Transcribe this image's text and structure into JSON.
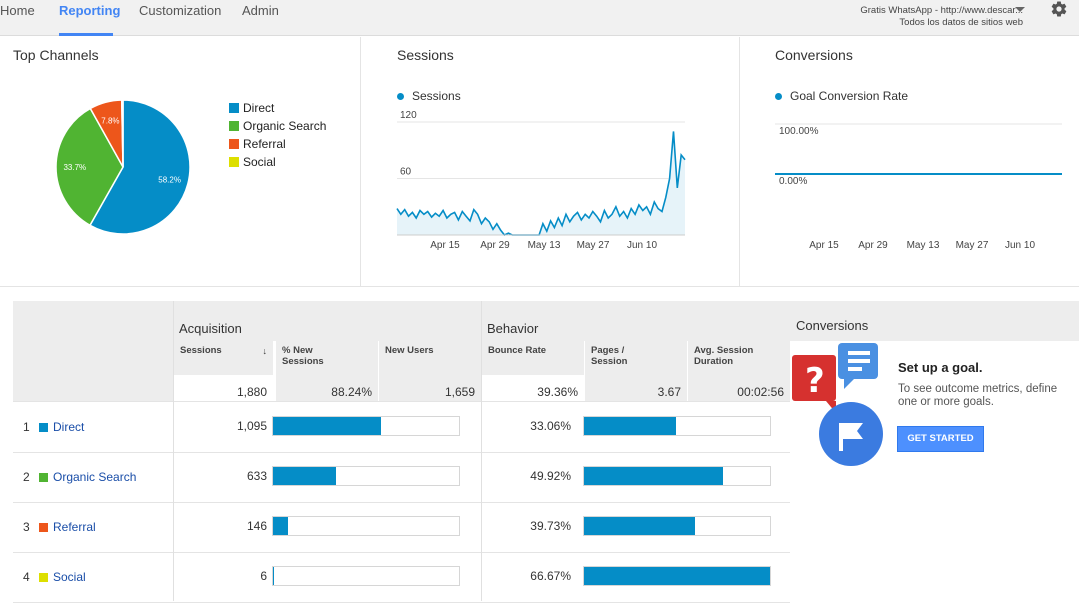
{
  "nav": {
    "tabs": [
      {
        "label": "Home"
      },
      {
        "label": "Reporting"
      },
      {
        "label": "Customization"
      },
      {
        "label": "Admin"
      }
    ],
    "account_line1": "Gratis WhatsApp - http://www.descar...",
    "account_line2": "Todos los datos de sitios web",
    "icons": [
      "chevron-down-icon",
      "gear-icon"
    ]
  },
  "top_channels": {
    "title": "Top Channels",
    "legend": [
      {
        "label": "Direct",
        "color": "#058dc7"
      },
      {
        "label": "Organic Search",
        "color": "#50b432"
      },
      {
        "label": "Referral",
        "color": "#ed561b"
      },
      {
        "label": "Social",
        "color": "#dddf00"
      }
    ]
  },
  "sessions_panel": {
    "title": "Sessions",
    "legend": "Sessions"
  },
  "conversions_panel": {
    "title": "Conversions",
    "legend": "Goal Conversion Rate"
  },
  "chart_data": [
    {
      "type": "pie",
      "title": "Top Channels",
      "categories": [
        "Direct",
        "Organic Search",
        "Referral",
        "Social"
      ],
      "values": [
        58.2,
        33.7,
        7.8,
        0.3
      ],
      "labels": [
        "58.2%",
        "33.7%",
        "7.8%",
        ""
      ],
      "colors": [
        "#058dc7",
        "#50b432",
        "#ed561b",
        "#dddf00"
      ],
      "legend": "right"
    },
    {
      "type": "area",
      "title": "Sessions",
      "series": [
        {
          "name": "Sessions",
          "values": [
            28,
            22,
            27,
            20,
            24,
            18,
            26,
            22,
            25,
            19,
            23,
            20,
            26,
            18,
            22,
            24,
            16,
            25,
            20,
            15,
            27,
            22,
            12,
            18,
            14,
            6,
            12,
            5,
            0,
            2,
            0,
            0,
            0,
            0,
            0,
            0,
            0,
            0,
            12,
            4,
            15,
            8,
            18,
            10,
            22,
            14,
            20,
            24,
            16,
            22,
            18,
            25,
            20,
            14,
            26,
            18,
            22,
            30,
            20,
            25,
            18,
            28,
            22,
            32,
            26,
            30,
            22,
            35,
            28,
            25,
            40,
            60,
            110,
            50,
            85,
            80
          ]
        }
      ],
      "xticks": [
        "Apr 15",
        "Apr 29",
        "May 13",
        "May 27",
        "Jun 10"
      ],
      "yticks": [
        "60",
        "120"
      ],
      "ylim": [
        0,
        120
      ],
      "grid": true
    },
    {
      "type": "line",
      "title": "Conversions",
      "series": [
        {
          "name": "Goal Conversion Rate",
          "values": [
            0,
            0
          ]
        }
      ],
      "xticks": [
        "Apr 15",
        "Apr 29",
        "May 13",
        "May 27",
        "Jun 10"
      ],
      "yticks": [
        "0.00%",
        "100.00%"
      ],
      "ylim": [
        0,
        100
      ],
      "grid": true
    }
  ],
  "table": {
    "groups": {
      "acquisition": "Acquisition",
      "behavior": "Behavior"
    },
    "columns": [
      {
        "label": "Sessions"
      },
      {
        "label": "% New Sessions"
      },
      {
        "label": "New Users"
      },
      {
        "label": "Bounce Rate"
      },
      {
        "label": "Pages / Session"
      },
      {
        "label": "Avg. Session Duration"
      }
    ],
    "sort_indicator": "↓",
    "totals": {
      "sessions": "1,880",
      "pct_new": "88.24%",
      "new_users": "1,659",
      "bounce": "39.36%",
      "pages": "3.67",
      "duration": "00:02:56"
    },
    "rows": [
      {
        "num": "1",
        "label": "Direct",
        "color": "#058dc7",
        "sessions": "1,095",
        "sessions_fraction": 0.582,
        "bounce": "33.06%",
        "bounce_fraction": 0.4959
      },
      {
        "num": "2",
        "label": "Organic Search",
        "color": "#50b432",
        "sessions": "633",
        "sessions_fraction": 0.337,
        "bounce": "49.92%",
        "bounce_fraction": 0.7488
      },
      {
        "num": "3",
        "label": "Referral",
        "color": "#ed561b",
        "sessions": "146",
        "sessions_fraction": 0.078,
        "bounce": "39.73%",
        "bounce_fraction": 0.5959
      },
      {
        "num": "4",
        "label": "Social",
        "color": "#dddf00",
        "sessions": "6",
        "sessions_fraction": 0.003,
        "bounce": "66.67%",
        "bounce_fraction": 1.0
      }
    ]
  },
  "goal": {
    "header": "Conversions",
    "title": "Set up a goal.",
    "text": "To see outcome metrics, define one or more goals.",
    "button": "GET STARTED"
  }
}
